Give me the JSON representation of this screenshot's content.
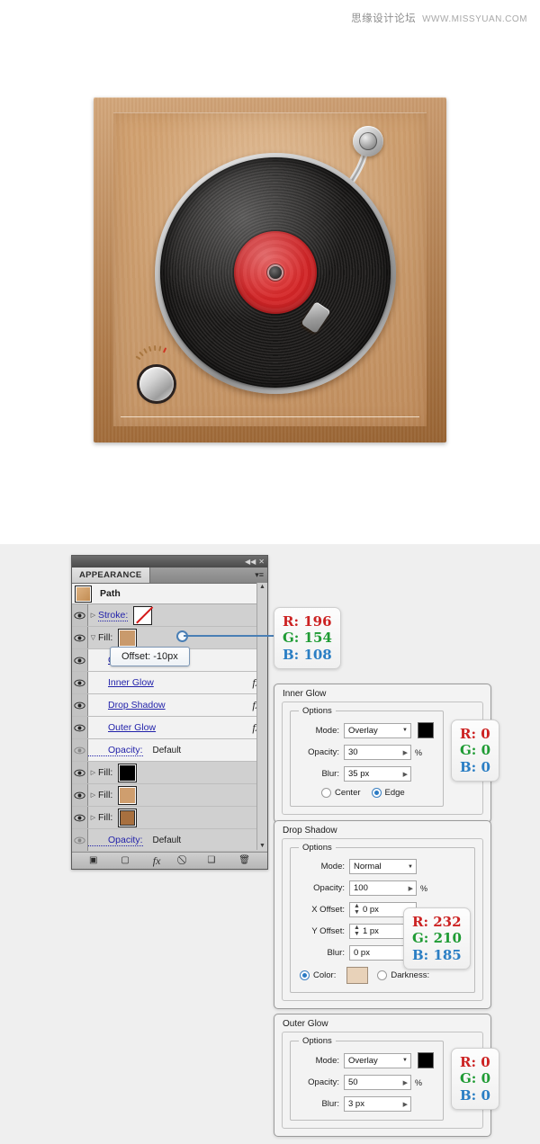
{
  "watermark": {
    "cn": "思缘设计论坛",
    "url": "WWW.MISSYUAN.COM"
  },
  "artwork": {
    "name": "vintage-turntable-icon",
    "record_label_color": "#d02527",
    "case_color": "#c58d55",
    "panel_color": "#c89a6c"
  },
  "panel": {
    "tab_label": "APPEARANCE",
    "collapse_icon": "◀◀",
    "close_icon": "✕",
    "menu_icon": "▾≡",
    "path_label": "Path",
    "rows": [
      {
        "label": "Stroke:",
        "kind": "stroke",
        "triangle": "▷",
        "swatch": "none",
        "eye": "on"
      },
      {
        "label": "Fill:",
        "kind": "fill",
        "triangle": "▽",
        "swatch": "#c99a6c",
        "eye": "on"
      },
      {
        "label": "Offset Path",
        "kind": "effect",
        "eye": "on"
      },
      {
        "label": "Inner Glow",
        "kind": "effect",
        "fx": "fx",
        "eye": "on"
      },
      {
        "label": "Drop Shadow",
        "kind": "effect",
        "fx": "fx",
        "eye": "on"
      },
      {
        "label": "Outer Glow",
        "kind": "effect",
        "fx": "fx",
        "eye": "on"
      },
      {
        "label": "Opacity:",
        "value": "Default",
        "kind": "opacity",
        "eye": "dim"
      },
      {
        "label": "Fill:",
        "kind": "fill",
        "triangle": "▷",
        "swatch": "#000000",
        "eye": "on"
      },
      {
        "label": "Fill:",
        "kind": "fill",
        "triangle": "▷",
        "swatch": "#cf9e6e",
        "eye": "on"
      },
      {
        "label": "Fill:",
        "kind": "fill",
        "triangle": "▷",
        "swatch": "#a8703f",
        "eye": "on"
      },
      {
        "label": "Opacity:",
        "value": "Default",
        "kind": "opacity",
        "eye": "dim"
      }
    ],
    "footer_icons": [
      "add-new-stroke",
      "add-new-fill",
      "add-new-effect",
      "clear-appearance",
      "duplicate-item",
      "delete-item"
    ],
    "footer_glyphs": [
      "▣",
      "▢",
      "fx",
      "⃠",
      "❑",
      "🗑"
    ]
  },
  "tooltip": {
    "text": "Offset: -10px"
  },
  "callouts": {
    "fill_color": {
      "r": "R: 196",
      "g": "G: 154",
      "b": "B: 108"
    },
    "inner_glow_color": {
      "r": "R: 0",
      "g": "G: 0",
      "b": "B: 0"
    },
    "drop_shadow_color": {
      "r": "R: 232",
      "g": "G: 210",
      "b": "B: 185"
    },
    "outer_glow_color": {
      "r": "R: 0",
      "g": "G: 0",
      "b": "B: 0"
    }
  },
  "inner_glow": {
    "title": "Inner Glow",
    "group": "Options",
    "mode_label": "Mode:",
    "mode_value": "Overlay",
    "opacity_label": "Opacity:",
    "opacity_value": "30",
    "opacity_unit": "%",
    "blur_label": "Blur:",
    "blur_value": "35 px",
    "center_label": "Center",
    "edge_label": "Edge",
    "selected": "Edge",
    "color": "#000000"
  },
  "drop_shadow": {
    "title": "Drop Shadow",
    "group": "Options",
    "mode_label": "Mode:",
    "mode_value": "Normal",
    "opacity_label": "Opacity:",
    "opacity_value": "100",
    "opacity_unit": "%",
    "xoffset_label": "X Offset:",
    "xoffset_value": "0 px",
    "yoffset_label": "Y Offset:",
    "yoffset_value": "1 px",
    "blur_label": "Blur:",
    "blur_value": "0 px",
    "color_label": "Color:",
    "darkness_label": "Darkness:",
    "selected": "Color",
    "color": "#e8d2b9"
  },
  "outer_glow": {
    "title": "Outer Glow",
    "group": "Options",
    "mode_label": "Mode:",
    "mode_value": "Overlay",
    "opacity_label": "Opacity:",
    "opacity_value": "50",
    "opacity_unit": "%",
    "blur_label": "Blur:",
    "blur_value": "3 px",
    "color": "#000000"
  }
}
